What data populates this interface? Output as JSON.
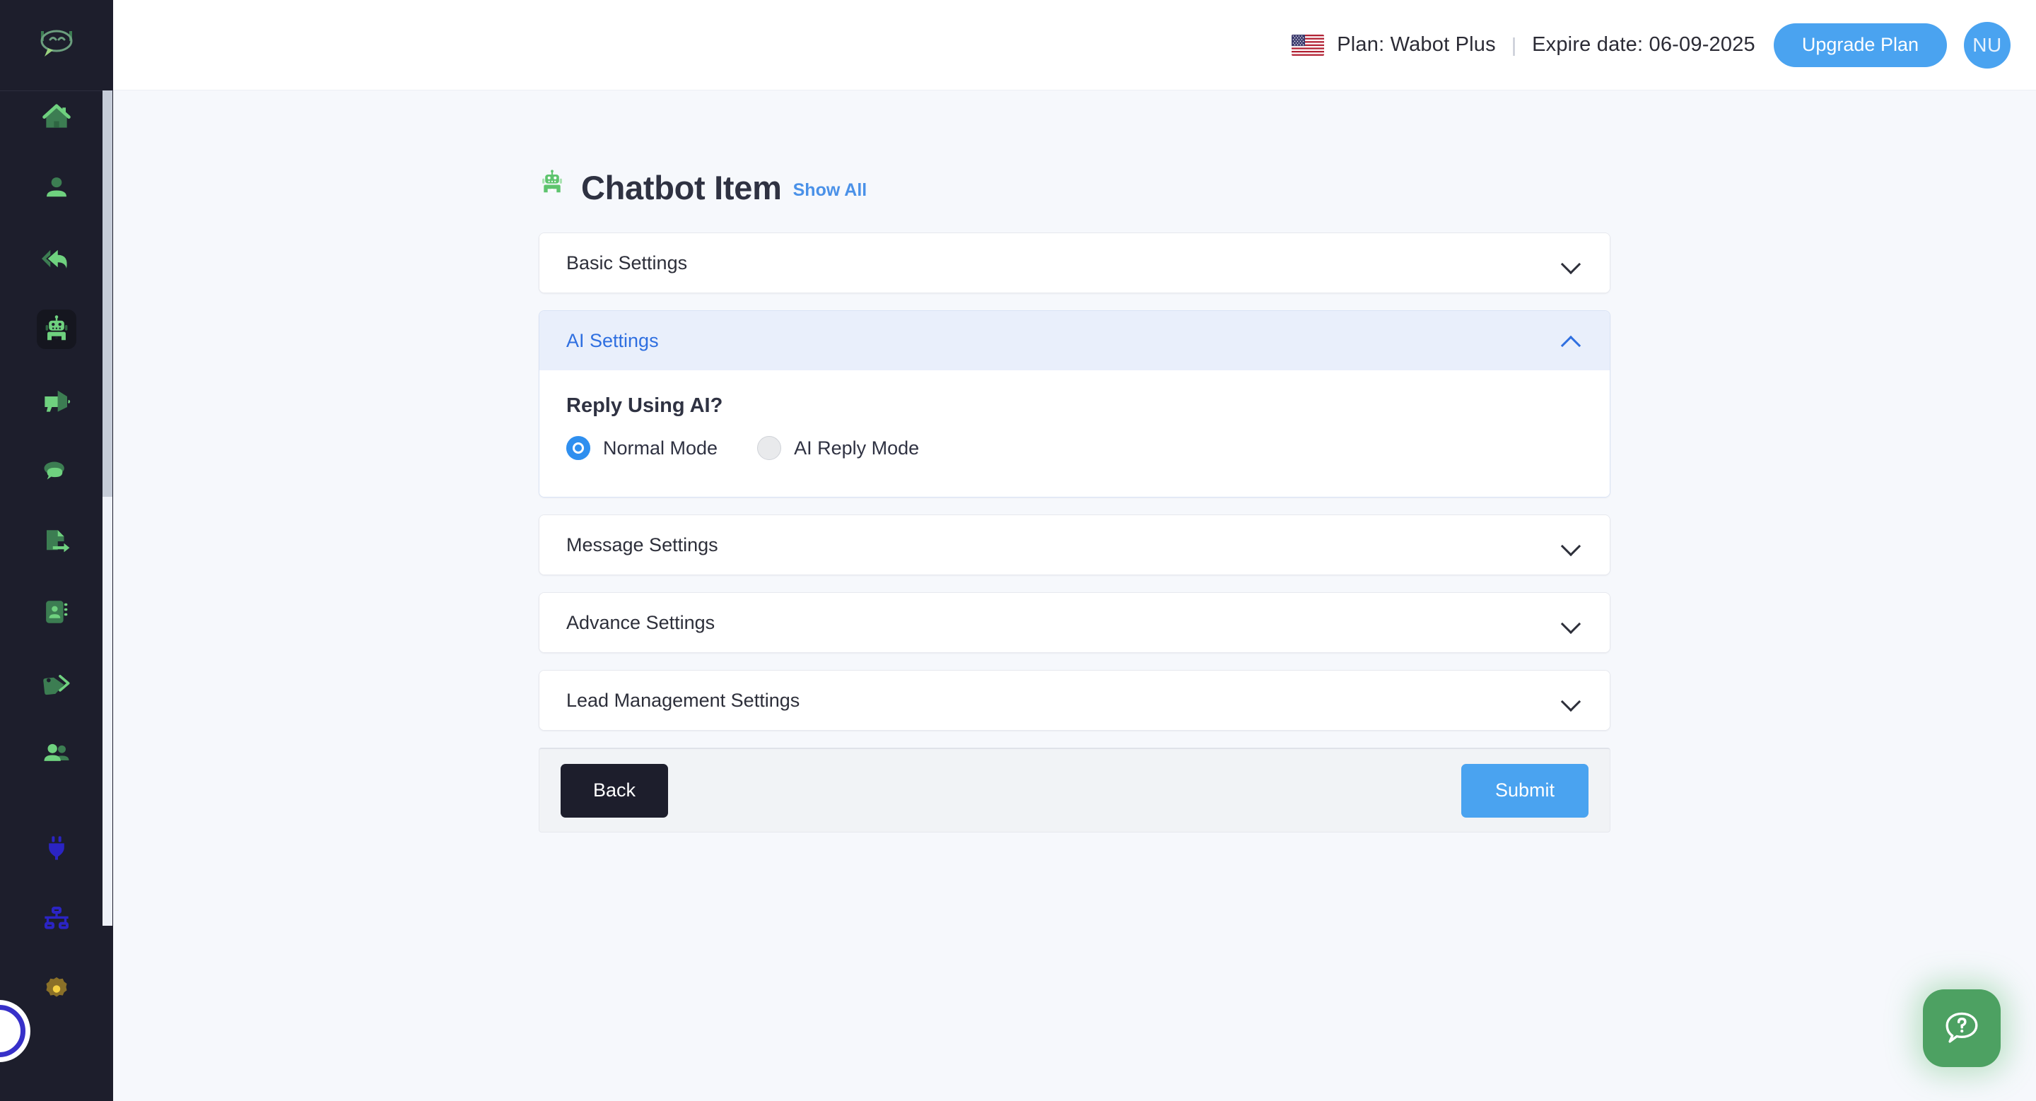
{
  "header": {
    "flag_icon": "us-flag-icon",
    "plan_label": "Plan: Wabot Plus",
    "separator": "|",
    "expire_label": "Expire date: 06-09-2025",
    "upgrade_button": "Upgrade Plan",
    "avatar_initials": "NU",
    "accent_color": "#4aa3f0"
  },
  "sidebar": {
    "logo_icon": "chat-bubble-logo-icon",
    "background_color": "#1d1e2c",
    "icon_color": "#5ec46e",
    "items": [
      {
        "name": "home",
        "icon": "home-icon",
        "active": false
      },
      {
        "name": "profile",
        "icon": "user-icon",
        "active": false
      },
      {
        "name": "auto-reply",
        "icon": "reply-arrow-icon",
        "active": false
      },
      {
        "name": "chatbot",
        "icon": "robot-icon",
        "active": true
      },
      {
        "name": "broadcast",
        "icon": "megaphone-icon",
        "active": false
      },
      {
        "name": "chats",
        "icon": "chat-bubbles-icon",
        "active": false
      },
      {
        "name": "export",
        "icon": "file-export-icon",
        "active": false
      },
      {
        "name": "contacts",
        "icon": "contact-book-icon",
        "active": false
      },
      {
        "name": "tags",
        "icon": "tags-icon",
        "active": false
      },
      {
        "name": "team",
        "icon": "users-group-icon",
        "active": false
      },
      {
        "name": "integrations",
        "icon": "plug-icon",
        "active": false
      },
      {
        "name": "flows",
        "icon": "sitemap-icon",
        "active": false
      },
      {
        "name": "settings",
        "icon": "gear-icon",
        "active": false
      }
    ]
  },
  "page": {
    "icon": "robot-icon",
    "title": "Chatbot Item",
    "show_all_link": "Show All"
  },
  "accordions": [
    {
      "label": "Basic Settings",
      "open": false,
      "chevron": "chevron-down-icon"
    },
    {
      "label": "AI Settings",
      "open": true,
      "chevron": "chevron-up-icon"
    },
    {
      "label": "Message Settings",
      "open": false,
      "chevron": "chevron-down-icon"
    },
    {
      "label": "Advance Settings",
      "open": false,
      "chevron": "chevron-down-icon"
    },
    {
      "label": "Lead Management Settings",
      "open": false,
      "chevron": "chevron-down-icon"
    }
  ],
  "ai_settings": {
    "question_label": "Reply Using AI?",
    "options": [
      {
        "label": "Normal Mode",
        "checked": true
      },
      {
        "label": "AI Reply Mode",
        "checked": false
      }
    ]
  },
  "form_footer": {
    "back_label": "Back",
    "submit_label": "Submit"
  },
  "help_fab": {
    "icon": "question-chat-icon",
    "color": "#4da162"
  }
}
